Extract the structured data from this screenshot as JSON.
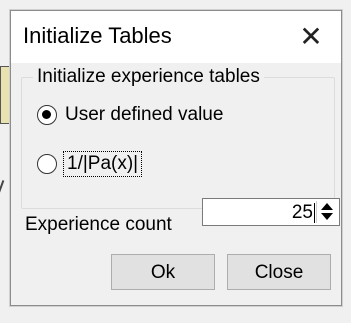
{
  "dialog": {
    "title": "Initialize Tables",
    "close_glyph": "✕",
    "group_label": "Initialize experience tables",
    "options": [
      {
        "label": "User defined value",
        "checked": true
      },
      {
        "label": "1/|Pa(x)|",
        "checked": false
      }
    ],
    "experience_count": {
      "label": "Experience count",
      "value": "25"
    },
    "buttons": {
      "ok": "Ok",
      "close": "Close"
    }
  },
  "colors": {
    "background": "#f0f0f0",
    "titlebar": "#ffffff",
    "button_face": "#e1e1e1",
    "canvas_accent": "#e8e2b0"
  }
}
